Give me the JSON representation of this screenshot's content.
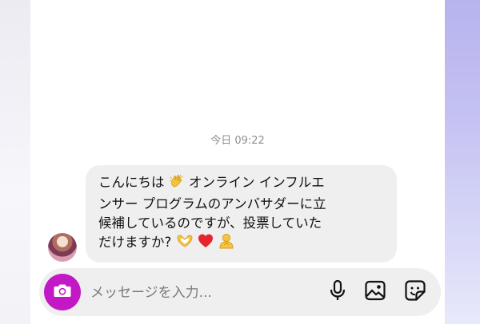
{
  "chat": {
    "timestamp": "今日 09:22",
    "message": {
      "line1": "こんにちは",
      "line1_after": " オンライン インフル",
      "line1_tail": "エ",
      "line2": "ンサー プログラムのアンバサダーに立",
      "line3": "候補しているのですが、投票していた",
      "line4": "だけますか?"
    },
    "emoji": {
      "wave": "waving-hand-icon",
      "heart_hands": "heart-hands-icon",
      "heart": "red-heart-icon",
      "bow": "bowing-person-icon"
    }
  },
  "composer": {
    "placeholder": "メッセージを入力...",
    "camera_icon": "camera-icon",
    "mic_icon": "microphone-icon",
    "gallery_icon": "gallery-icon",
    "sticker_icon": "sticker-icon",
    "camera_color": "#c318c6"
  }
}
